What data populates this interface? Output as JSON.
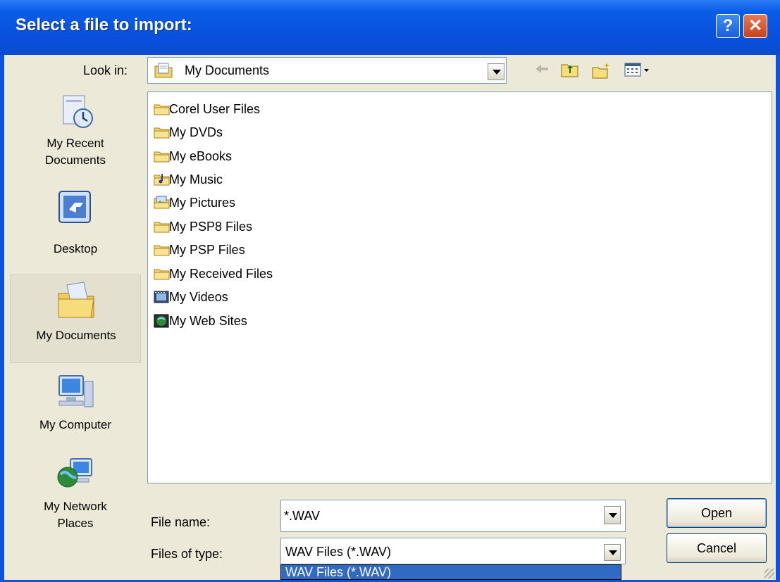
{
  "window": {
    "title": "Select a file to import:",
    "help_glyph": "?",
    "close_glyph": "✕"
  },
  "lookin": {
    "label": "Look in:",
    "value": "My Documents"
  },
  "toolbar": {
    "icons": [
      "back-icon",
      "up-folder-icon",
      "new-folder-icon",
      "views-menu-icon"
    ]
  },
  "places": [
    {
      "label_line1": "My Recent",
      "label_line2": "Documents",
      "icon": "recent-documents-icon"
    },
    {
      "label_line1": "Desktop",
      "label_line2": "",
      "icon": "desktop-icon"
    },
    {
      "label_line1": "My Documents",
      "label_line2": "",
      "icon": "my-documents-icon"
    },
    {
      "label_line1": "My Computer",
      "label_line2": "",
      "icon": "my-computer-icon"
    },
    {
      "label_line1": "My Network",
      "label_line2": "Places",
      "icon": "network-places-icon"
    }
  ],
  "files": [
    {
      "label": "Corel User Files",
      "icon": "folder-icon"
    },
    {
      "label": "My DVDs",
      "icon": "folder-icon"
    },
    {
      "label": "My eBooks",
      "icon": "folder-icon"
    },
    {
      "label": "My Music",
      "icon": "music-folder-icon"
    },
    {
      "label": "My Pictures",
      "icon": "pictures-folder-icon"
    },
    {
      "label": "My PSP8 Files",
      "icon": "folder-icon"
    },
    {
      "label": "My PSP Files",
      "icon": "folder-icon"
    },
    {
      "label": "My Received Files",
      "icon": "folder-icon"
    },
    {
      "label": "My Videos",
      "icon": "videos-folder-icon"
    },
    {
      "label": "My Web Sites",
      "icon": "web-sites-folder-icon"
    }
  ],
  "filename": {
    "label": "File name:",
    "value": "*.WAV"
  },
  "filetype": {
    "label": "Files of type:",
    "value": "WAV Files (*.WAV)",
    "dropdown_option": "WAV Files (*.WAV)"
  },
  "buttons": {
    "open": "Open",
    "cancel": "Cancel"
  },
  "colors": {
    "titlebar": "#0852e0",
    "dialog_bg": "#ece9d8",
    "selection": "#316ac5",
    "close_button": "#c7401c"
  }
}
